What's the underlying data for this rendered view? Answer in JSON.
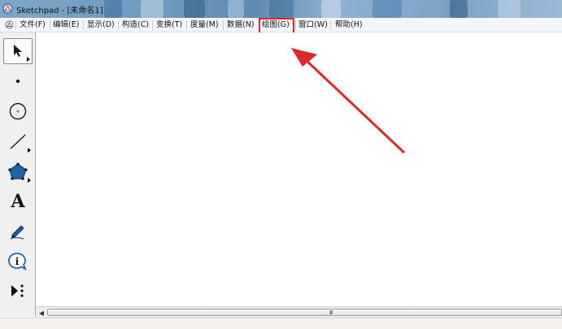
{
  "window": {
    "title": "Sketchpad - [未命名1]"
  },
  "menu": {
    "items": [
      {
        "label": "文件(F)"
      },
      {
        "label": "编辑(E)"
      },
      {
        "label": "显示(D)"
      },
      {
        "label": "构造(C)"
      },
      {
        "label": "变换(T)"
      },
      {
        "label": "度量(M)"
      },
      {
        "label": "数据(N)"
      },
      {
        "label": "绘图(G)"
      },
      {
        "label": "窗口(W)"
      },
      {
        "label": "帮助(H)"
      }
    ],
    "highlighted": "绘图(G)"
  },
  "toolbox": {
    "tools": [
      {
        "icon": "arrow-select-icon",
        "selected": true
      },
      {
        "icon": "point-icon"
      },
      {
        "icon": "compass-circle-icon"
      },
      {
        "icon": "straightedge-icon"
      },
      {
        "icon": "polygon-icon"
      },
      {
        "icon": "text-tool-icon",
        "glyph": "A"
      },
      {
        "icon": "marker-pen-icon"
      },
      {
        "icon": "information-icon",
        "glyph": "i"
      },
      {
        "icon": "custom-tool-icon"
      }
    ]
  },
  "scrollbar": {
    "grip": "III"
  },
  "colors": {
    "annotation": "#e0282c",
    "toolbox_bg": "#f0f0f0",
    "menubar_bg": "#f3f6fa"
  }
}
